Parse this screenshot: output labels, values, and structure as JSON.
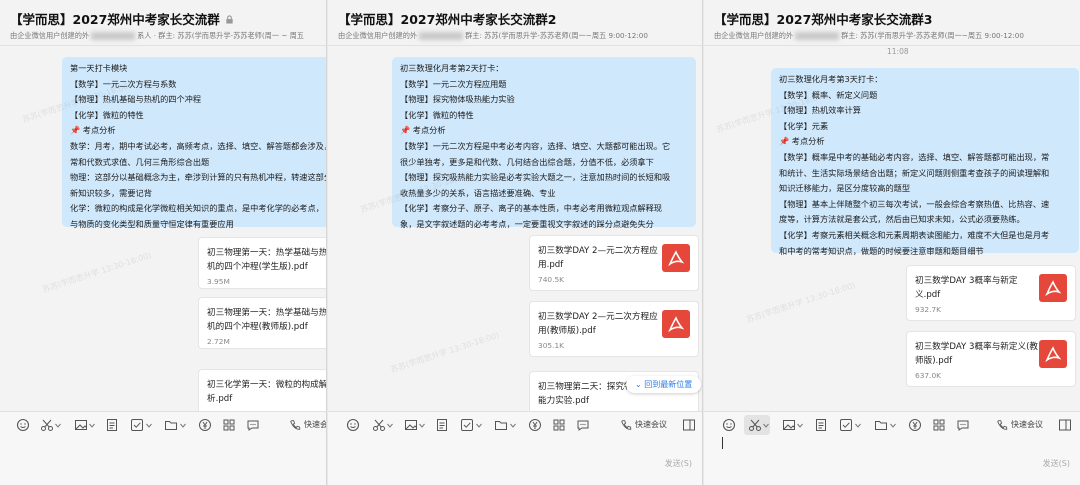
{
  "windows": [
    {
      "title": "【学而思】2027郑州中考家长交流群",
      "subtitle_pre": "由企业微信用户创建的外",
      "subtitle_post": "系人 · 群主: 苏苏(学而思升学-苏苏老师(周一 ~ 周五",
      "message": {
        "lines": [
          "第一天打卡模块",
          "【数学】一元二次方程与系数",
          "【物理】热机基础与热机的四个冲程",
          "【化学】微粒的特性",
          "📌 考点分析",
          "数学：月考，期中考试必考，高频考点，选择、填空、解答题都会涉及，",
          "常和代数式求值、几何三角形综合出题",
          "物理：这部分以基础概念为主，牵涉到计算的只有热机冲程，转速这部分",
          "新知识较多，需要记背",
          "化学：微粒的构成是化学微粒相关知识的重点，是中考化学的必考点，",
          "与物质的变化类型和质量守恒定律有重要应用"
        ]
      },
      "files": [
        {
          "name": "初三物理第一天：热学基础与热机的四个冲程(学生版).pdf",
          "size": "3.95M"
        },
        {
          "name": "初三物理第一天：热学基础与热机的四个冲程(教师版).pdf",
          "size": "2.72M"
        },
        {
          "name": "初三化学第一天：微粒的构成解析.pdf",
          "size": ""
        }
      ],
      "toolbar": {
        "quick_meeting": "快速会议"
      }
    },
    {
      "title": "【学而思】2027郑州中考家长交流群2",
      "subtitle_pre": "由企业微信用户创建的外",
      "subtitle_post": "群主: 苏苏(学而思升学-苏苏老师(周一~周五 9:00-12:00",
      "message": {
        "lines": [
          "初三数理化月考第2天打卡：",
          "【数学】一元二次方程应用题",
          "【物理】探究物体吸热能力实验",
          "【化学】微粒的特性",
          "📌 考点分析",
          "【数学】一元二次方程是中考必考内容，选择、填空、大题都可能出现。它",
          "很少单独考，更多是和代数、几何结合出综合题，分值不低，必须拿下",
          "【物理】探究吸热能力实验是必考实验大题之一，注意加热时间的长短和吸",
          "收热量多少的关系，语言描述要准确、专业",
          "【化学】考察分子、原子、离子的基本性质，中考必考用微粒观点解释现",
          "象，是文字叙述题的必考考点，一定要重视文字叙述的踩分点避免失分"
        ]
      },
      "files": [
        {
          "name": "初三数学DAY 2—元二次方程应用.pdf",
          "size": "740.5K"
        },
        {
          "name": "初三数学DAY 2—元二次方程应用(教师版).pdf",
          "size": "305.1K"
        },
        {
          "name": "初三物理第二天：探究物体吸热能力实验.pdf",
          "size": ""
        }
      ],
      "new_position": "回到最新位置",
      "toolbar": {
        "quick_meeting": "快速会议"
      },
      "send": "发送(S)"
    },
    {
      "title": "【学而思】2027郑州中考家长交流群3",
      "subtitle_pre": "由企业微信用户创建的外",
      "subtitle_post": "群主: 苏苏(学而思升学-苏苏老师(周一~周五 9:00-12:00",
      "timestamp": "11:08",
      "message": {
        "lines": [
          "初三数理化月考第3天打卡：",
          "【数学】概率、新定义问题",
          "【物理】热机效率计算",
          "【化学】元素",
          "📌 考点分析",
          "【数学】概率是中考的基础必考内容，选择、填空、解答题都可能出现，常",
          "和统计、生活实际场景结合出题；新定义问题则侧重考查孩子的阅读理解和",
          "知识迁移能力，是区分度较高的题型",
          "【物理】基本上伴随整个初三每次考试，一般会综合考察热值、比热容、速",
          "度等，计算方法就是套公式，然后由已知求未知，公式必须要熟练。",
          "【化学】考察元素相关概念和元素周期表读图能力，难度不大但是也是月考",
          "和中考的常考知识点，做题的时候要注意审题和题目细节"
        ]
      },
      "files": [
        {
          "name": "初三数学DAY 3概率与新定义.pdf",
          "size": "932.7K"
        },
        {
          "name": "初三数学DAY 3概率与新定义(教师版).pdf",
          "size": "637.0K"
        }
      ],
      "toolbar": {
        "quick_meeting": "快速会议"
      },
      "send": "发送(S)"
    }
  ],
  "icons": [
    "emoji-icon",
    "scissors-icon",
    "image-icon",
    "document-icon",
    "checkbox-icon",
    "folder-icon",
    "money-icon",
    "apps-icon",
    "chat-icon",
    "phone-icon",
    "split-icon",
    "lock-icon",
    "pdf-icon",
    "pin-icon",
    "chevron-down-icon"
  ],
  "colors": {
    "bubble": "#cfe8fc",
    "pdf_red": "#e5483b",
    "link_blue": "#2a7ae2"
  }
}
